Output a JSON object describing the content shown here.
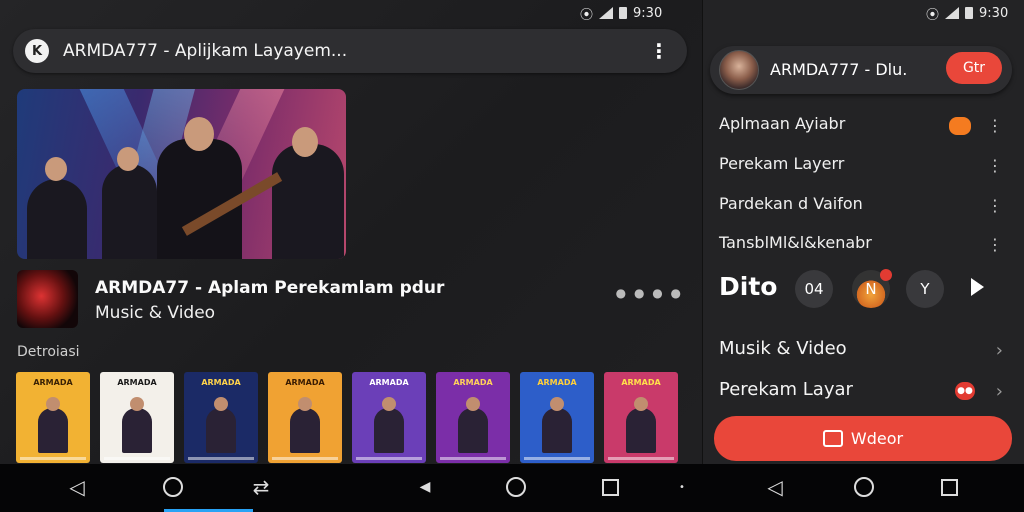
{
  "status_left": {
    "time": "9:30"
  },
  "status_right": {
    "time": "9:30"
  },
  "urlbar": {
    "title": "ARMDA777 - Aplijkam Layayem..."
  },
  "track": {
    "title": "ARMDA77 - Aplam Perekamlam pdur",
    "subtitle": "Music & Video"
  },
  "section": {
    "label": "Detroiasi"
  },
  "cards": [
    {
      "caption": "ARMADA",
      "bg": "#f2b233",
      "fg": "#3a2205"
    },
    {
      "caption": "ARMADA",
      "bg": "#f3f0ea",
      "fg": "#1a1a1a"
    },
    {
      "caption": "ARMADA",
      "bg": "#1b2a66",
      "fg": "#ffd34a"
    },
    {
      "caption": "ARMADA",
      "bg": "#f0a233",
      "fg": "#3a1c02"
    },
    {
      "caption": "ARMADA",
      "bg": "#6b3fb8",
      "fg": "#ffffff"
    },
    {
      "caption": "ARMADA",
      "bg": "#7b2ea8",
      "fg": "#ffd15a"
    },
    {
      "caption": "ARMADA",
      "bg": "#2d5ec9",
      "fg": "#ffcf3a"
    },
    {
      "caption": "ARMADA",
      "bg": "#c93a6a",
      "fg": "#ffe14a"
    }
  ],
  "profile": {
    "name": "ARMDA777 - Dlu.",
    "button": "Gtr"
  },
  "menu": [
    {
      "label": "Aplmaan Ayiabr"
    },
    {
      "label": "Perekam Layerr"
    },
    {
      "label": "Pardekan d Vaifon"
    },
    {
      "label": "TansblMl&l&kenabr"
    }
  ],
  "controls": {
    "label": "Dito",
    "btn1": "04",
    "btn2": "N",
    "btn3": "Y"
  },
  "links": [
    {
      "label": "Musik & Video"
    },
    {
      "label": "Perekam Layar"
    }
  ],
  "bigbutton": {
    "label": "Wdeor"
  },
  "colors": {
    "accent": "#e9473a",
    "nav_indicator": "#29a3f5"
  }
}
